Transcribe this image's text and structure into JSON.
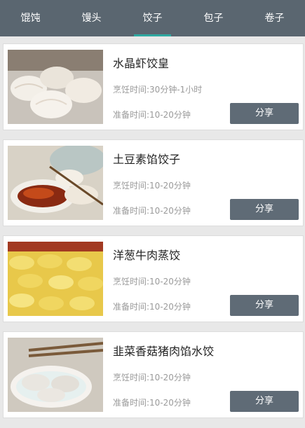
{
  "tabs": [
    {
      "label": "馄饨",
      "active": false
    },
    {
      "label": "馒头",
      "active": false
    },
    {
      "label": "饺子",
      "active": true
    },
    {
      "label": "包子",
      "active": false
    },
    {
      "label": "卷子",
      "active": false
    }
  ],
  "accent_color": "#2fa8a0",
  "tabbar_color": "#5a6670",
  "recipes": [
    {
      "title": "水晶虾饺皇",
      "cook_time": "烹饪时间:30分钟-1小时",
      "prep_time": "准备时间:10-20分钟",
      "share_label": "分享"
    },
    {
      "title": "土豆素馅饺子",
      "cook_time": "烹饪时间:10-20分钟",
      "prep_time": "准备时间:10-20分钟",
      "share_label": "分享"
    },
    {
      "title": "洋葱牛肉蒸饺",
      "cook_time": "烹饪时间:10-20分钟",
      "prep_time": "准备时间:10-20分钟",
      "share_label": "分享"
    },
    {
      "title": "韭菜香菇猪肉馅水饺",
      "cook_time": "烹饪时间:10-20分钟",
      "prep_time": "准备时间:10-20分钟",
      "share_label": "分享"
    }
  ]
}
